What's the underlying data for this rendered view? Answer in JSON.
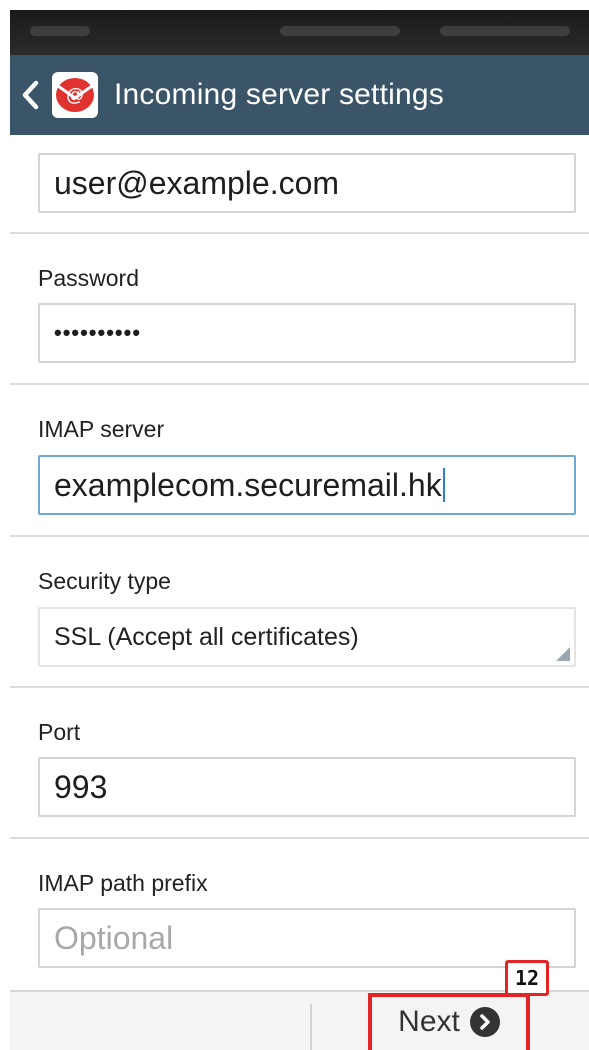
{
  "header": {
    "title": "Incoming server settings",
    "back_icon": "chevron-left-icon",
    "app_icon": "email-app-icon",
    "bar_color": "#3a5468"
  },
  "fields": {
    "username": {
      "value": "user@example.com"
    },
    "password": {
      "label": "Password",
      "value": "••••••••••"
    },
    "imap_server": {
      "label": "IMAP server",
      "value": "examplecom.securemail.hk"
    },
    "security_type": {
      "label": "Security type",
      "value": "SSL (Accept all certificates)"
    },
    "port": {
      "label": "Port",
      "value": "993"
    },
    "imap_path_prefix": {
      "label": "IMAP path prefix",
      "placeholder": "Optional",
      "value": ""
    }
  },
  "footer": {
    "next_label": "Next",
    "next_icon": "chevron-right-circle-icon"
  },
  "annotation": {
    "step_number": "12",
    "highlight_color": "#e52525"
  }
}
